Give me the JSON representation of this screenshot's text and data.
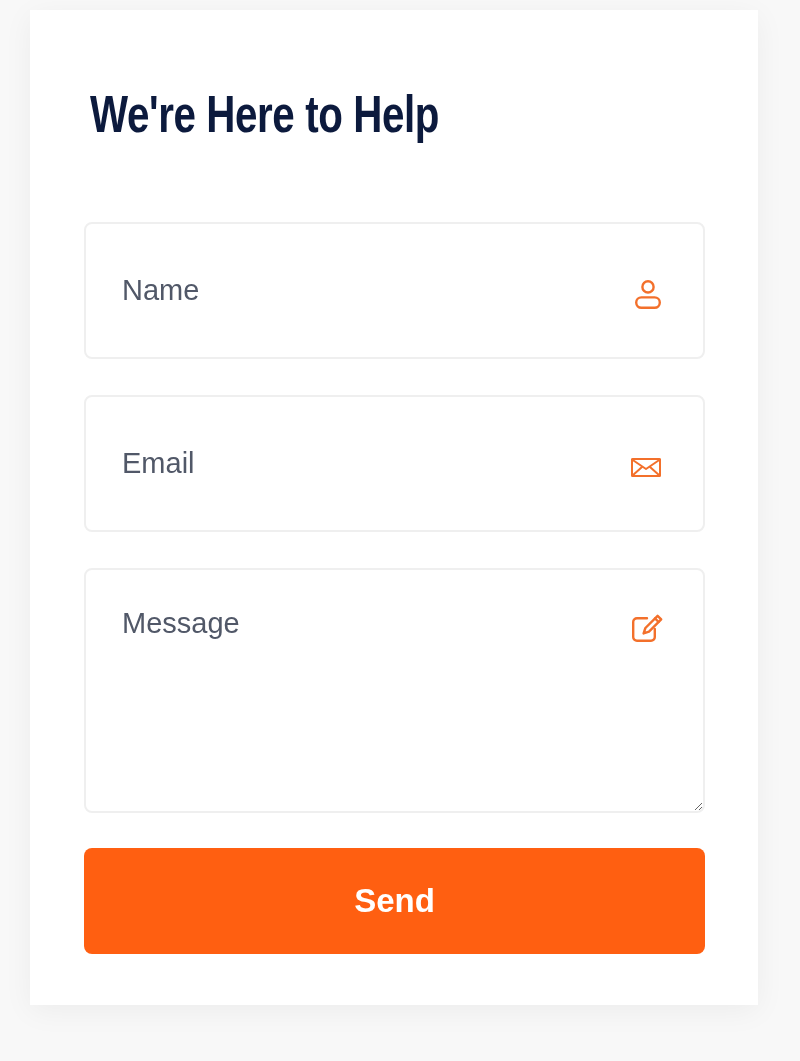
{
  "form": {
    "title": "We're Here to Help",
    "fields": [
      {
        "kind": "text",
        "placeholder": "Name"
      },
      {
        "kind": "email",
        "placeholder": "Email"
      },
      {
        "kind": "textarea",
        "placeholder": "Message"
      }
    ],
    "submit": {
      "label": "Send"
    }
  }
}
